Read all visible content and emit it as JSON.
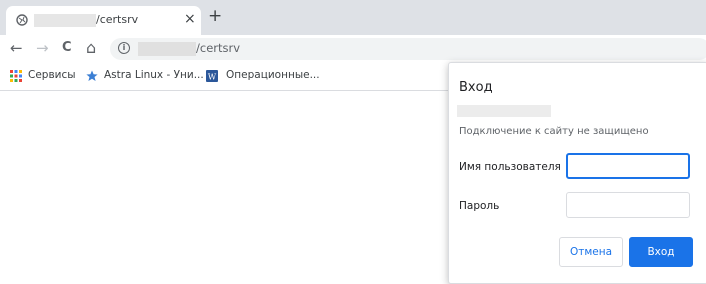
{
  "tab": {
    "title": "/certsrv",
    "close_glyph": "×",
    "new_tab_glyph": "+"
  },
  "toolbar": {
    "back_glyph": "←",
    "forward_glyph": "→",
    "reload_glyph": "C",
    "home_glyph": "⌂",
    "info_glyph": "i",
    "url_path": "/certsrv"
  },
  "bookmarks": {
    "items": [
      {
        "label": "Сервисы",
        "icon": "apps-grid-icon"
      },
      {
        "label": "Astra Linux - Уни...",
        "icon": "star-icon"
      },
      {
        "label": "Операционные...",
        "icon": "w-icon"
      }
    ]
  },
  "dialog": {
    "title": "Вход",
    "subtitle": "Подключение к сайту не защищено",
    "username_label": "Имя пользователя",
    "password_label": "Пароль",
    "username_value": "",
    "password_value": "",
    "cancel_label": "Отмена",
    "ok_label": "Вход"
  },
  "colors": {
    "accent": "#1a73e8",
    "tabstrip": "#dee1e6",
    "omnibox": "#f1f3f4"
  }
}
